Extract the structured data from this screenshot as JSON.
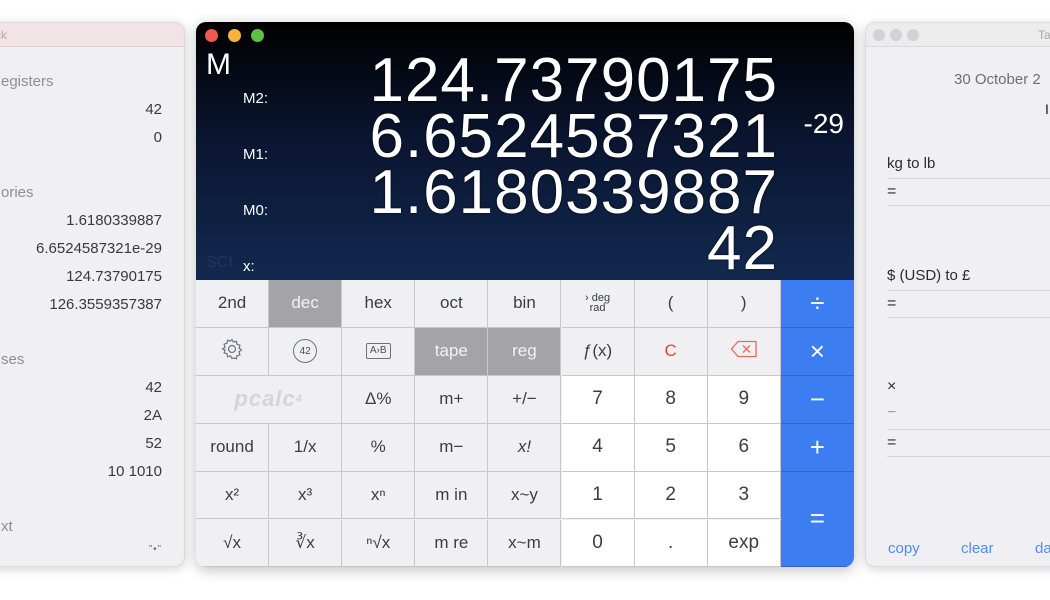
{
  "left_panel": {
    "title_fragment": "ck",
    "sections": [
      {
        "label": "egisters",
        "values": [
          "42",
          "0"
        ]
      },
      {
        "label": "ories",
        "values": [
          "1.6180339887",
          "6.6524587321e-29",
          "124.73790175",
          "126.3559357387"
        ]
      },
      {
        "label": "ses",
        "values": [
          "42",
          "2A",
          "52",
          "10 1010"
        ]
      },
      {
        "label": "xt",
        "values": []
      }
    ],
    "footer_icon": "”•”"
  },
  "calculator": {
    "window_buttons": [
      "close",
      "minimize",
      "zoom"
    ],
    "mode_indicator": "M",
    "sci_label": "SCI",
    "registers": [
      {
        "label": "M2:",
        "value": "124.73790175"
      },
      {
        "label": "M1:",
        "value": "6.6524587321",
        "exponent": "-29"
      },
      {
        "label": "M0:",
        "value": "1.6180339887"
      },
      {
        "label": "x:",
        "value": "42"
      }
    ],
    "keys": [
      [
        {
          "label": "2nd"
        },
        {
          "label": "dec",
          "active": true
        },
        {
          "label": "hex"
        },
        {
          "label": "oct"
        },
        {
          "label": "bin"
        },
        {
          "label": "deg/rad",
          "top": "deg",
          "bottom": "rad"
        },
        {
          "label": "("
        },
        {
          "label": ")"
        },
        {
          "label": "÷",
          "type": "op"
        }
      ],
      [
        {
          "label": "settings",
          "icon": "gear-icon"
        },
        {
          "label": "42",
          "icon": "circled-42-icon"
        },
        {
          "label": "A›B",
          "icon": "a-to-b-icon"
        },
        {
          "label": "tape",
          "active": true
        },
        {
          "label": "reg",
          "active": true
        },
        {
          "label": "ƒ(x)"
        },
        {
          "label": "C",
          "red": true
        },
        {
          "label": "delete",
          "icon": "backspace-icon"
        },
        {
          "label": "×",
          "type": "op"
        }
      ],
      [
        {
          "label": "pcalc",
          "superscript": "4",
          "logo": true
        },
        {
          "label": "Δ%"
        },
        {
          "label": "m+"
        },
        {
          "label": "+/−"
        },
        {
          "label": "7",
          "type": "num"
        },
        {
          "label": "8",
          "type": "num"
        },
        {
          "label": "9",
          "type": "num"
        },
        {
          "label": "−",
          "type": "op"
        }
      ],
      [
        {
          "label": "round"
        },
        {
          "label": "1/x"
        },
        {
          "label": "%"
        },
        {
          "label": "m−"
        },
        {
          "label": "x!"
        },
        {
          "label": "4",
          "type": "num"
        },
        {
          "label": "5",
          "type": "num"
        },
        {
          "label": "6",
          "type": "num"
        },
        {
          "label": "+",
          "type": "op"
        }
      ],
      [
        {
          "label": "x²"
        },
        {
          "label": "x³"
        },
        {
          "label": "xⁿ"
        },
        {
          "label": "m in"
        },
        {
          "label": "x~y"
        },
        {
          "label": "1",
          "type": "num"
        },
        {
          "label": "2",
          "type": "num"
        },
        {
          "label": "3",
          "type": "num"
        },
        {
          "label": "=",
          "type": "op"
        }
      ],
      [
        {
          "label": "√x"
        },
        {
          "label": "∛x"
        },
        {
          "label": "ⁿ√x"
        },
        {
          "label": "m re"
        },
        {
          "label": "x~m"
        },
        {
          "label": "0",
          "type": "num"
        },
        {
          "label": ".",
          "type": "num"
        },
        {
          "label": "exp",
          "type": "num"
        }
      ]
    ],
    "colors": {
      "operator": "#3c7ef2",
      "active": "#a4a4a8",
      "clear": "#e0453a"
    }
  },
  "right_panel": {
    "title_fragment": "Ta",
    "date": "30 October 2",
    "mark": "I",
    "conversions": [
      {
        "label": "kg to lb",
        "result_prefix": "="
      },
      {
        "label": "$ (USD) to £",
        "result_prefix": "="
      }
    ],
    "tape": {
      "op1": "×",
      "op2": "−",
      "result_prefix": "="
    },
    "buttons": [
      "copy",
      "clear",
      "da"
    ]
  }
}
